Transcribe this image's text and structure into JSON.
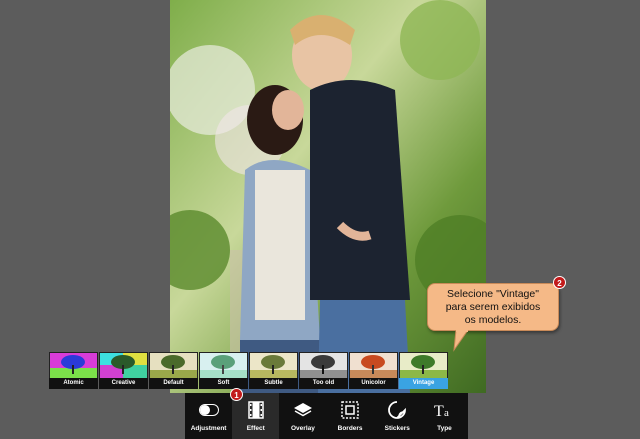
{
  "photo": {
    "description_icon": "couple-photo"
  },
  "effects": {
    "items": [
      {
        "label": "Atomic",
        "icon": "tree-thumb"
      },
      {
        "label": "Creative",
        "icon": "tree-thumb"
      },
      {
        "label": "Default",
        "icon": "tree-thumb"
      },
      {
        "label": "Soft",
        "icon": "tree-thumb"
      },
      {
        "label": "Subtle",
        "icon": "tree-thumb"
      },
      {
        "label": "Too old",
        "icon": "tree-thumb"
      },
      {
        "label": "Unicolor",
        "icon": "tree-thumb"
      },
      {
        "label": "Vintage",
        "icon": "tree-thumb"
      }
    ],
    "selected": "Vintage"
  },
  "toolbar": {
    "items": [
      {
        "label": "Adjustment",
        "icon": "toggle-icon"
      },
      {
        "label": "Effect",
        "icon": "film-icon"
      },
      {
        "label": "Overlay",
        "icon": "layers-icon"
      },
      {
        "label": "Borders",
        "icon": "frame-icon"
      },
      {
        "label": "Stickers",
        "icon": "sticker-icon"
      },
      {
        "label": "Type",
        "icon": "type-icon"
      }
    ],
    "active": "Effect"
  },
  "badges": {
    "step1": "1",
    "step2": "2"
  },
  "callout": {
    "line1": "Selecione \"Vintage\"",
    "line2": "para serem exibidos",
    "line3": "os modelos."
  },
  "colors": {
    "background": "#5c5c5c",
    "toolbar": "#111111",
    "selected": "#3aa3e3",
    "badge": "#c21a1a",
    "callout": "#f5b987"
  }
}
